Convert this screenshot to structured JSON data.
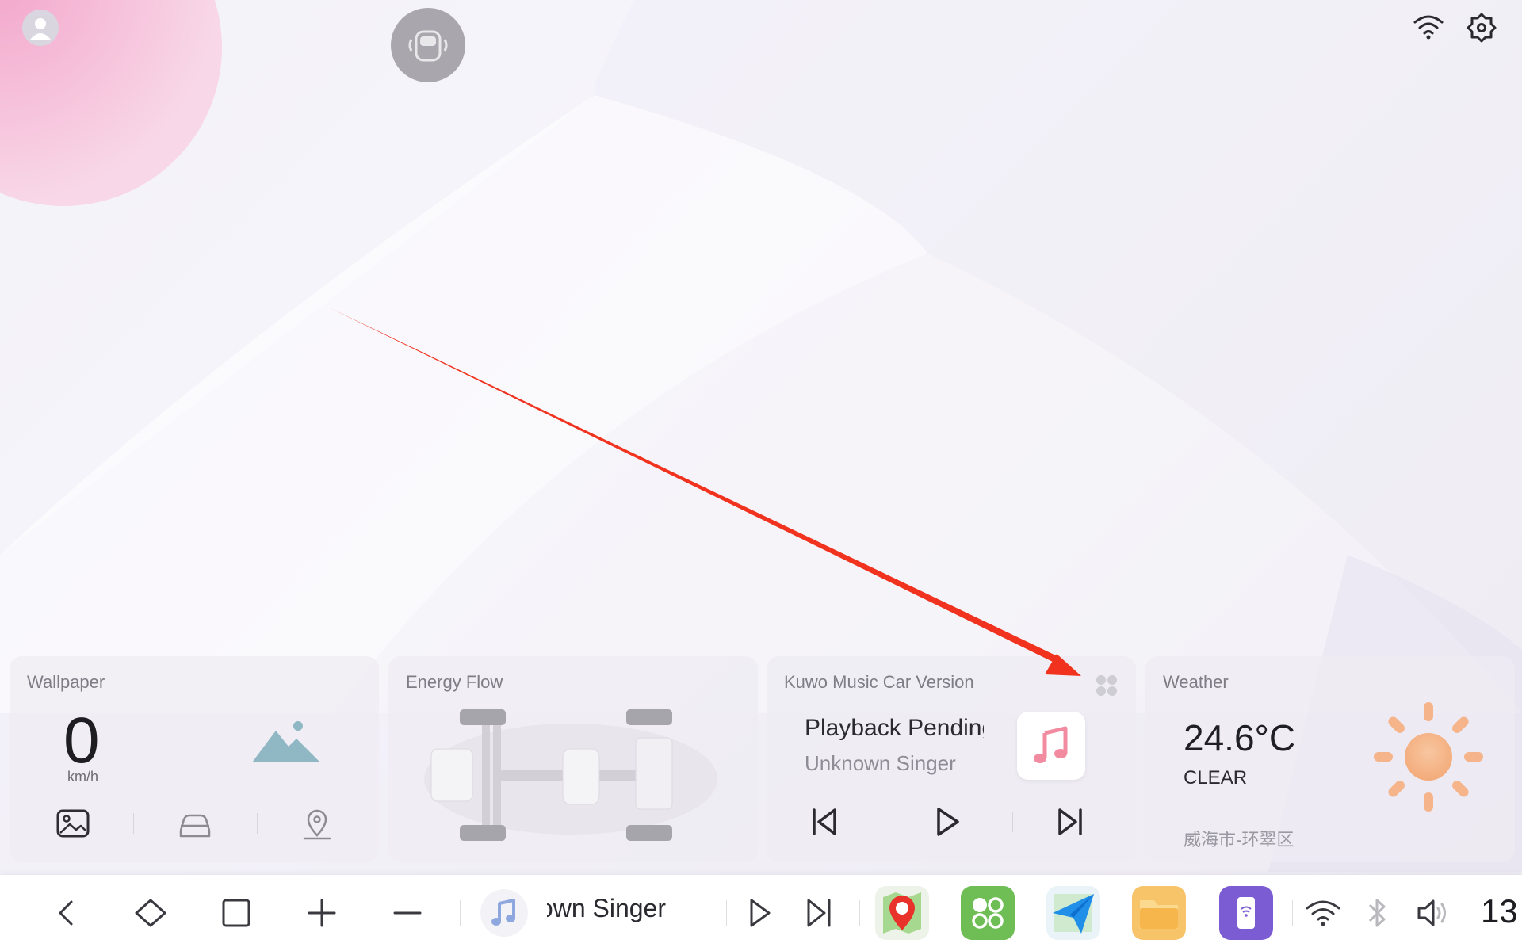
{
  "widgets": {
    "wallpaper": {
      "title": "Wallpaper",
      "speed": "0",
      "speed_unit": "km/h"
    },
    "energy": {
      "title": "Energy Flow"
    },
    "music": {
      "title": "Kuwo Music Car Version",
      "track": "Playback Pending",
      "artist": "Unknown Singer"
    },
    "weather": {
      "title": "Weather",
      "temperature": "24.6°C",
      "condition": "CLEAR",
      "location": "威海市-环翠区"
    }
  },
  "taskbar": {
    "now_playing": "Unknown Singer",
    "clock": "13"
  },
  "icons": {
    "top": [
      "avatar-icon",
      "car-mode-icon",
      "wifi-icon",
      "settings-icon"
    ],
    "nav": [
      "back-icon",
      "home-icon",
      "recents-icon",
      "volume-up-icon",
      "volume-down-icon"
    ],
    "apps": [
      "baidu-maps-app-icon",
      "apps-grid-app-icon",
      "navigation-app-icon",
      "file-manager-app-icon",
      "phone-mirror-app-icon"
    ],
    "status": [
      "wifi-icon",
      "bluetooth-icon",
      "volume-icon"
    ]
  },
  "colors": {
    "annotation_arrow": "#f0321e",
    "weather_sun": "#f5b48a",
    "mountain": "#8fb7c4"
  }
}
